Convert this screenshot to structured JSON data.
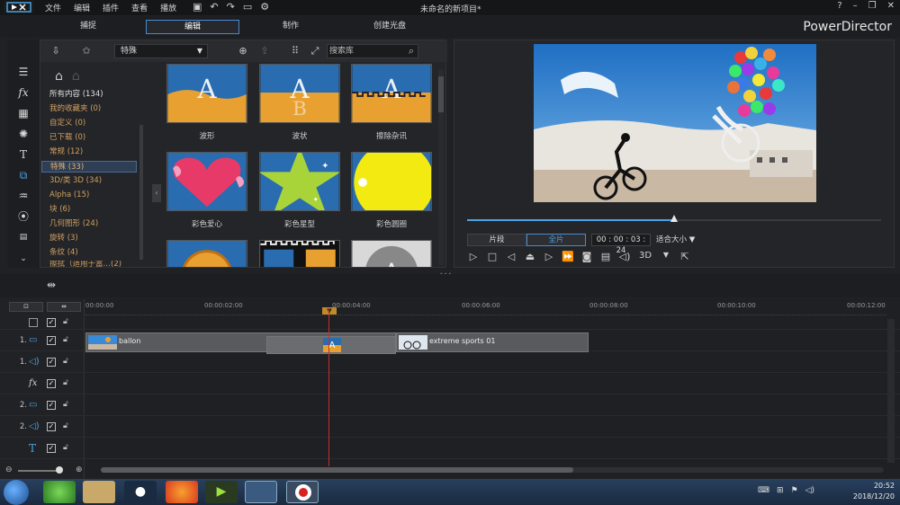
{
  "menu": [
    "文件",
    "编辑",
    "插件",
    "查看",
    "播放"
  ],
  "window_title": "未命名的新项目*",
  "modes": [
    {
      "label": "捕捉",
      "active": false
    },
    {
      "label": "编辑",
      "active": true
    },
    {
      "label": "制作",
      "active": false
    },
    {
      "label": "创建光盘",
      "active": false
    }
  ],
  "brand": "PowerDirector",
  "library": {
    "dropdown": "特殊",
    "search_placeholder": "搜索库",
    "categories": [
      {
        "label": "所有内容 (134)"
      },
      {
        "label": "我的收藏夹 (0)"
      },
      {
        "label": "自定义 (0)"
      },
      {
        "label": "已下载 (0)"
      },
      {
        "label": "常规 (12)"
      },
      {
        "label": "特殊 (33)",
        "selected": true
      },
      {
        "label": "3D/类 3D (34)"
      },
      {
        "label": "Alpha (15)"
      },
      {
        "label": "块 (6)"
      },
      {
        "label": "几何图形 (24)"
      },
      {
        "label": "旋转 (3)"
      },
      {
        "label": "条纹 (4)"
      },
      {
        "label": "擦拭（适用于富…(2)"
      }
    ],
    "tiles": [
      {
        "label": "波形"
      },
      {
        "label": "波状"
      },
      {
        "label": "擦除杂讯"
      },
      {
        "label": "彩色爱心"
      },
      {
        "label": "彩色星型"
      },
      {
        "label": "彩色圆圈"
      }
    ]
  },
  "preview": {
    "progress": 0.5,
    "tab_clip": "片段",
    "tab_movie": "全片",
    "timecode": "00 : 00 : 03 : 24",
    "fit": "适合大小",
    "mode3d": "3D"
  },
  "timeline": {
    "ticks": [
      "00:00:00",
      "00:00:02:00",
      "00:00:04:00",
      "00:00:06:00",
      "00:00:08:00",
      "00:00:10:00",
      "00:00:12:00"
    ],
    "tracks": [
      {
        "label": "1.",
        "icon": "video-track-icon"
      },
      {
        "label": "1.",
        "icon": "audio-track-icon"
      },
      {
        "label": "",
        "icon": "fx-track-icon"
      },
      {
        "label": "2.",
        "icon": "video-track-icon"
      },
      {
        "label": "2.",
        "icon": "audio-track-icon"
      },
      {
        "label": "",
        "icon": "title-track-icon"
      }
    ],
    "clips": [
      {
        "name": "ballon"
      },
      {
        "name": "extreme sports 01"
      }
    ]
  },
  "taskbar": {
    "time": "20:52",
    "date": "2018/12/20"
  },
  "colors": {
    "accent": "#4aa3e0",
    "playhead": "#c03030",
    "category": "#d0a060"
  }
}
